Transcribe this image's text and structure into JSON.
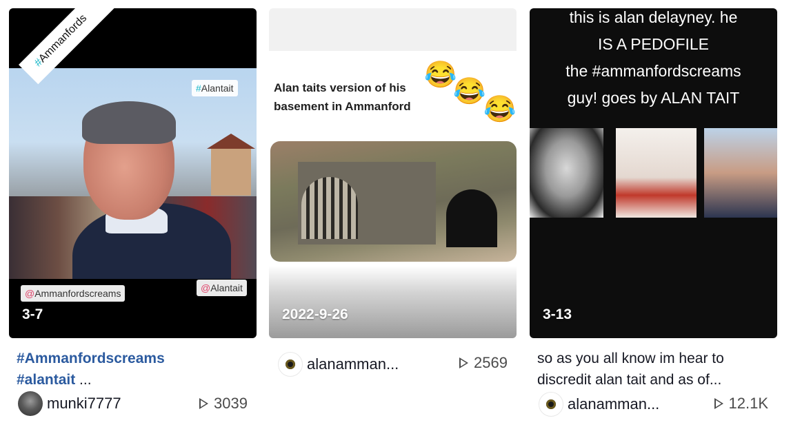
{
  "cards": [
    {
      "date": "3-7",
      "ribbon_tag": "Ammanfords",
      "badge_top": "Alantait",
      "badge_bottom_left": "Ammanfordscreams",
      "badge_bottom_right": "Alantait",
      "description_tag1": "#Ammanfordscreams",
      "description_tag2": "#alantait",
      "description_ellipsis": "...",
      "username": "munki7777",
      "views": "3039"
    },
    {
      "date": "2022-9-26",
      "caption_line1": "Alan taits version of his",
      "caption_line2": "basement in Ammanford",
      "emoji": "😂",
      "username": "alanamman...",
      "views": "2569"
    },
    {
      "date": "3-13",
      "overlay_line1": "this is alan delayney. he",
      "overlay_line2": "IS A PEDOFILE",
      "overlay_line3": "the #ammanfordscreams",
      "overlay_line4": "guy! goes by ALAN TAIT",
      "description": "so as you all know im hear to discredit alan tait and as of...",
      "username": "alanamman...",
      "views": "12.1K"
    }
  ],
  "symbols": {
    "hash": "#",
    "at": "@"
  },
  "colors": {
    "hashtag": "#2b5a9f",
    "tag_hash_symbol": "#1cb8c9",
    "tag_at_symbol": "#e0446a"
  },
  "icons": [
    "play-icon",
    "avatar"
  ]
}
